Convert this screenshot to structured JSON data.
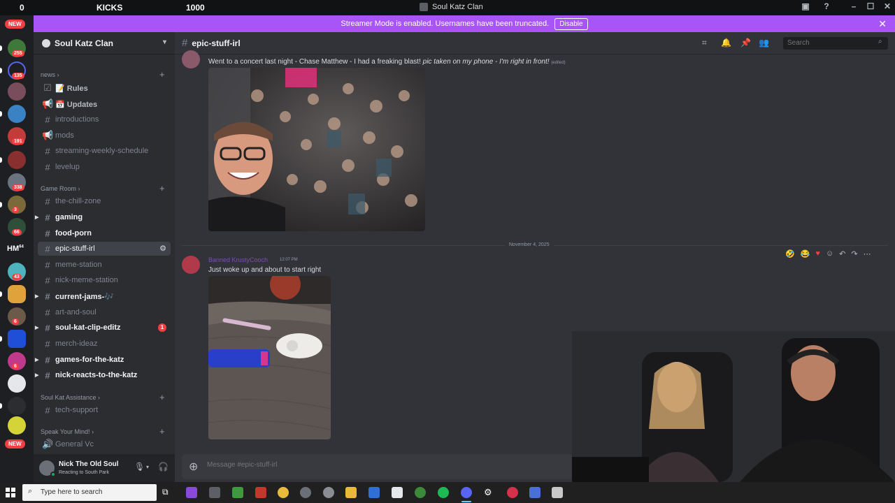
{
  "overlay": {
    "left_count": "0",
    "kicks_label": "KICKS",
    "kicks_count": "1000",
    "window_title": "Soul Katz Clan"
  },
  "server_rail": {
    "new_label_top": "NEW",
    "new_label_bottom": "NEW",
    "hm_label": "HM",
    "hm_badge": "64",
    "badges": [
      "255",
      "135",
      "191",
      "338",
      "3",
      "66",
      "43",
      "6",
      "6"
    ]
  },
  "banner": {
    "message": "Streamer Mode is enabled. Usernames have been truncated.",
    "disable_label": "Disable"
  },
  "server": {
    "name": "Soul Katz Clan"
  },
  "categories": {
    "news": "news",
    "game_room": "Game Room",
    "assistance": "Soul Kat Assistance",
    "speak": "Speak Your Mind!"
  },
  "channels": {
    "rules": "📝 Rules",
    "updates": "📅 Updates",
    "introductions": "introductions",
    "mods": "mods",
    "schedule": "streaming-weekly-schedule",
    "levelup": "levelup",
    "chill": "the-chill-zone",
    "gaming": "gaming",
    "food": "food-porn",
    "epic": "epic-stuff-irl",
    "meme": "meme-station",
    "nick_meme": "nick-meme-station",
    "jams": "current-jams-🎶",
    "art": "art-and-soul",
    "clip": "soul-kat-clip-editz",
    "clip_badge": "1",
    "merch": "merch-ideaz",
    "games": "games-for-the-katz",
    "reacts": "nick-reacts-to-the-katz",
    "support": "tech-support",
    "general_vc": "General Vc"
  },
  "user": {
    "name": "Nick The Old Soul",
    "activity": "Reacting to South Park"
  },
  "chat": {
    "channel_name": "epic-stuff-irl",
    "search_placeholder": "Search",
    "msg1_text": "Went to a concert last night - Chase Matthew - I had a freaking blast! ",
    "msg1_italic": "pic taken on my phone - I'm right in front!",
    "msg1_edited": "(edited)",
    "date_divider": "November 4, 2025",
    "msg2_author": "Banned KrustyCooch",
    "msg2_time": "12:07 PM",
    "msg2_text": "Just woke up and about to start right",
    "composer_placeholder": "Message #epic-stuff-irl"
  },
  "taskbar": {
    "search_placeholder": "Type here to search"
  },
  "colors": {
    "banner": "#a855f7",
    "mention_red": "#f23f43",
    "author_purple": "#7d4fad"
  }
}
